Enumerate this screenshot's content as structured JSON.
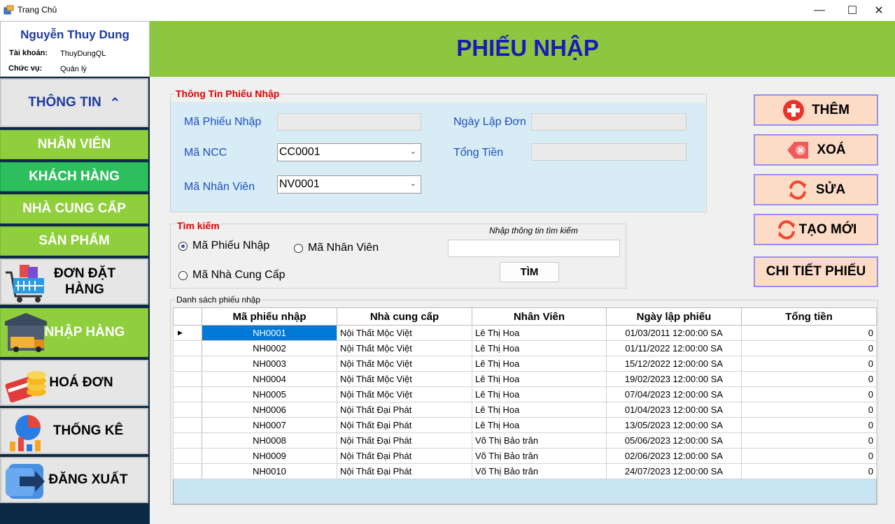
{
  "window": {
    "title": "Trang Chủ"
  },
  "user": {
    "name": "Nguyễn Thuy Dung",
    "account_label": "Tài khoản:",
    "account": "ThuyDungQL",
    "role_label": "Chức vụ:",
    "role": "Quản lý"
  },
  "menu": {
    "info": "THÔNG TIN",
    "staff": "NHÂN VIÊN",
    "customers": "KHÁCH HÀNG",
    "suppliers": "NHÀ CUNG CẤP",
    "products": "SẢN PHẨM",
    "orders": "ĐƠN ĐẶT HÀNG",
    "imports": "NHẬP HÀNG",
    "invoices": "HOÁ ĐƠN",
    "stats": "THỐNG KÊ",
    "logout": "ĐĂNG XUẤT"
  },
  "header": {
    "title": "PHIẾU NHẬP"
  },
  "info": {
    "legend": "Thông Tin Phiếu Nhập",
    "receipt_id_label": "Mã Phiếu Nhập",
    "date_label": "Ngày Lập Đơn",
    "supplier_label": "Mã NCC",
    "supplier_value": "CC0001",
    "total_label": "Tổng Tiền",
    "staff_label": "Mã Nhân Viên",
    "staff_value": "NV0001"
  },
  "search": {
    "legend": "Tìm kiếm",
    "opt_receipt": "Mã Phiếu Nhập",
    "opt_staff": "Mã Nhân Viên",
    "opt_supplier": "Mã Nhà Cung Cấp",
    "input_label": "Nhập thông tin tìm kiếm",
    "button": "TÌM"
  },
  "actions": {
    "add": "THÊM",
    "delete": "XOÁ",
    "edit": "SỬA",
    "new": "TẠO MỚI",
    "detail": "CHI TIẾT PHIẾU"
  },
  "colors": {
    "header_green": "#8dc63f",
    "title_blue": "#1a1ab8",
    "selection": "#0078d7",
    "action_bg": "#fddcc7"
  },
  "list": {
    "legend": "Danh sách phiếu nhập",
    "columns": [
      "Mã phiếu nhập",
      "Nhà cung cấp",
      "Nhân Viên",
      "Ngày lập phiếu",
      "Tổng tiền"
    ],
    "rows": [
      [
        "NH0001",
        "Nội Thất Mộc Việt",
        "Lê Thị Hoa",
        "01/03/2011 12:00:00 SA",
        "0"
      ],
      [
        "NH0002",
        "Nội Thất Mộc Việt",
        "Lê Thị Hoa",
        "01/11/2022 12:00:00 SA",
        "0"
      ],
      [
        "NH0003",
        "Nội Thất Mộc Việt",
        "Lê Thị Hoa",
        "15/12/2022 12:00:00 SA",
        "0"
      ],
      [
        "NH0004",
        "Nội Thất Mộc Việt",
        "Lê Thị Hoa",
        "19/02/2023 12:00:00 SA",
        "0"
      ],
      [
        "NH0005",
        "Nội Thất Mộc Việt",
        "Lê Thị Hoa",
        "07/04/2023 12:00:00 SA",
        "0"
      ],
      [
        "NH0006",
        "Nội Thất Đại Phát",
        "Lê Thị Hoa",
        "01/04/2023 12:00:00 SA",
        "0"
      ],
      [
        "NH0007",
        "Nội Thất Đại Phát",
        "Lê Thị Hoa",
        "13/05/2023 12:00:00 SA",
        "0"
      ],
      [
        "NH0008",
        "Nội Thất Đại Phát",
        "Võ Thị Bảo trân",
        "05/06/2023 12:00:00 SA",
        "0"
      ],
      [
        "NH0009",
        "Nội Thất Đại Phát",
        "Võ Thị Bảo trân",
        "02/06/2023 12:00:00 SA",
        "0"
      ],
      [
        "NH0010",
        "Nội Thất Đại Phát",
        "Võ Thị Bảo trân",
        "24/07/2023 12:00:00 SA",
        "0"
      ]
    ]
  }
}
